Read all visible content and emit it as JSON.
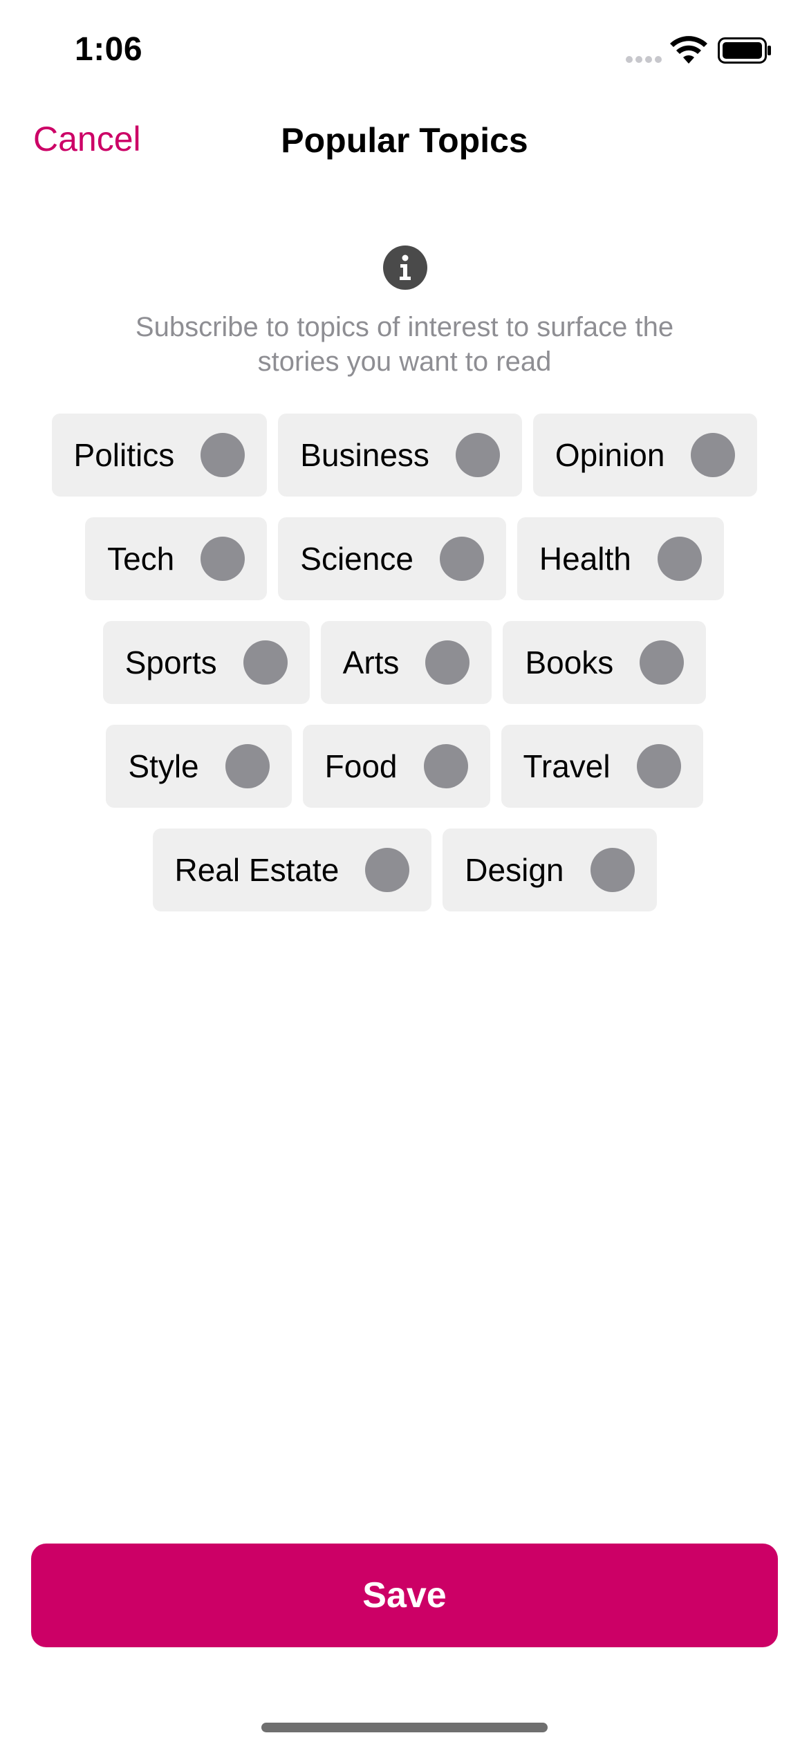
{
  "status_bar": {
    "time": "1:06",
    "icons": [
      "signal-icon",
      "wifi-icon",
      "battery-icon"
    ]
  },
  "nav": {
    "cancel_label": "Cancel",
    "title": "Popular Topics"
  },
  "info": {
    "icon": "info-icon",
    "subtitle": "Subscribe to topics of interest to surface the stories you want to read"
  },
  "topics": [
    [
      "Politics",
      "Business",
      "Opinion"
    ],
    [
      "Tech",
      "Science",
      "Health"
    ],
    [
      "Sports",
      "Arts",
      "Books"
    ],
    [
      "Style",
      "Food",
      "Travel"
    ],
    [
      "Real Estate",
      "Design"
    ]
  ],
  "save_label": "Save",
  "colors": {
    "accent": "#cc0066",
    "chip_background": "#efefef",
    "unselected_indicator": "#8e8e93",
    "subtitle_text": "#8e8e93"
  }
}
